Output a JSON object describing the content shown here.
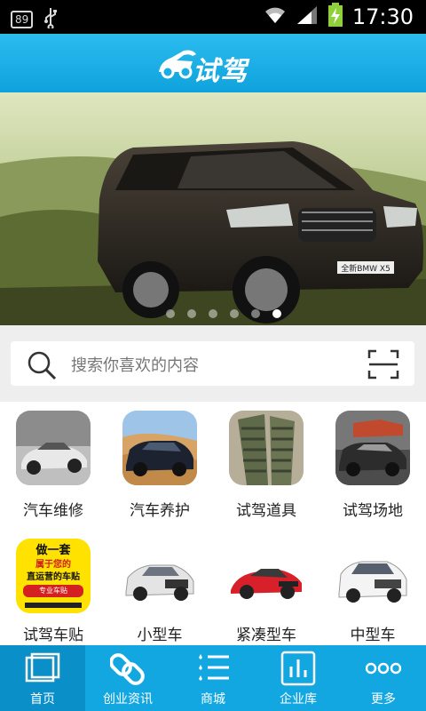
{
  "status_bar": {
    "notification_badge": "89",
    "time": "17:30",
    "icons": [
      "usb-icon",
      "wifi-icon",
      "signal-icon",
      "battery-charging-icon"
    ]
  },
  "header": {
    "logo_text": "试驾"
  },
  "banner": {
    "slide_count": 6,
    "active_slide": 6,
    "car_badge": "全新BMW X5"
  },
  "search": {
    "placeholder": "搜索你喜欢的内容"
  },
  "categories": [
    {
      "label": "汽车维修",
      "icon": "silver-sports-car"
    },
    {
      "label": "汽车养护",
      "icon": "suv-in-desert"
    },
    {
      "label": "试驾道具",
      "icon": "ramp-obstacles"
    },
    {
      "label": "试驾场地",
      "icon": "suv-on-course"
    },
    {
      "label": "试驾车贴",
      "icon": "sticker-poster"
    },
    {
      "label": "小型车",
      "icon": "white-audi-suv"
    },
    {
      "label": "紧凑型车",
      "icon": "red-sedan"
    },
    {
      "label": "中型车",
      "icon": "white-suv"
    }
  ],
  "sticker_text": {
    "line1": "做一套",
    "line2": "属于您的",
    "line3": "直运营的车贴",
    "line4": "专业车贴"
  },
  "bottom_nav": [
    {
      "label": "首页",
      "icon": "home-icon",
      "active": true
    },
    {
      "label": "创业资讯",
      "icon": "link-icon",
      "active": false
    },
    {
      "label": "商城",
      "icon": "list-icon",
      "active": false
    },
    {
      "label": "企业库",
      "icon": "chart-icon",
      "active": false
    },
    {
      "label": "更多",
      "icon": "more-icon",
      "active": false
    }
  ],
  "colors": {
    "brand": "#13a7e2",
    "nav_active": "#0a8fc8"
  }
}
